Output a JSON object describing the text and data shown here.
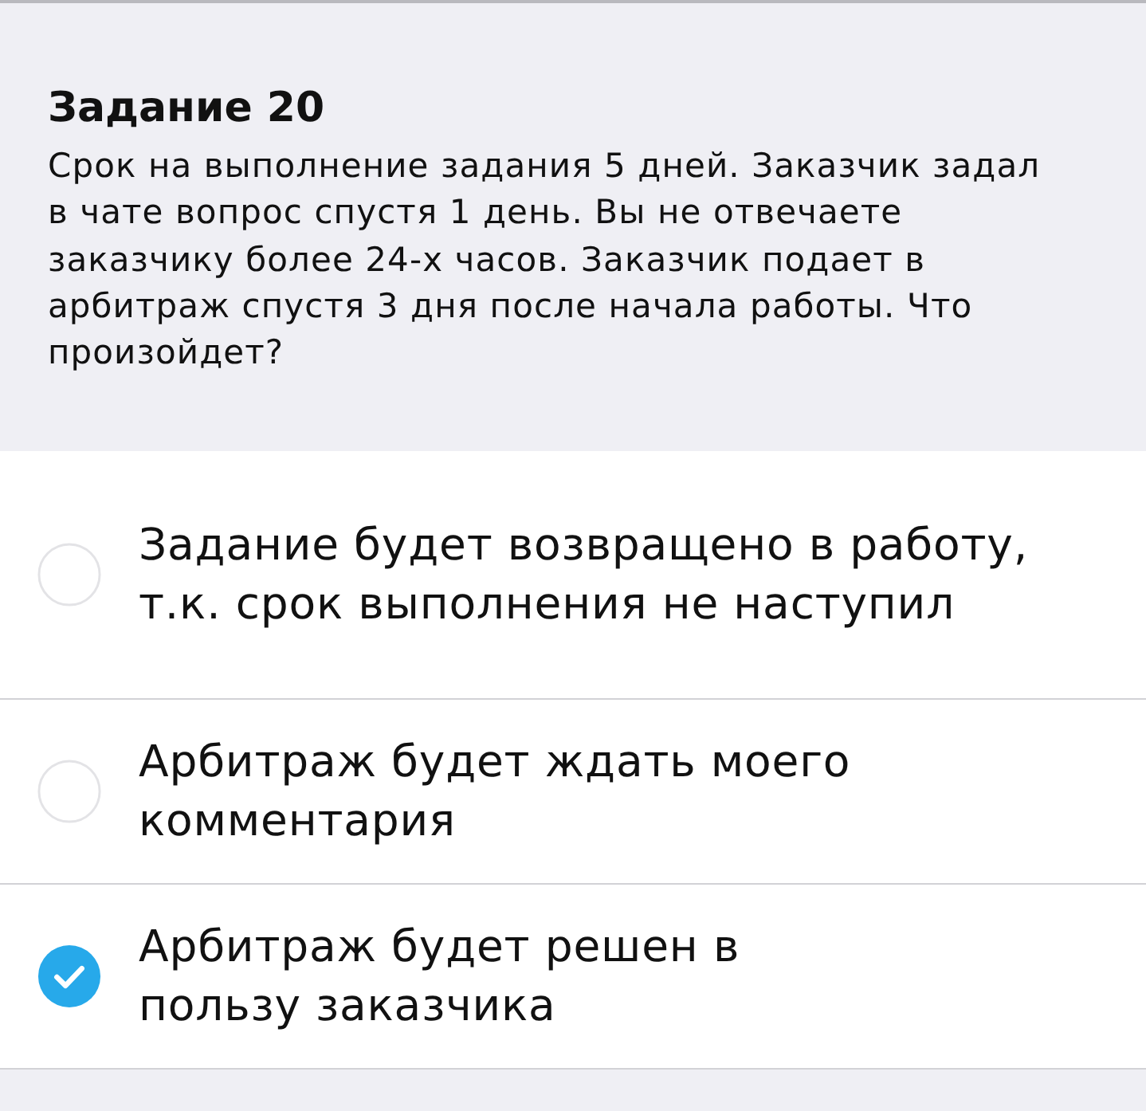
{
  "task": {
    "title": "Задание 20",
    "question": "Срок на выполнение задания 5 дней. Заказчик задал в чате вопрос спустя 1 день. Вы не отвечаете заказчику более 24-х часов. Заказчик подает в арбитраж спустя 3 дня после начала работы. Что произойдет?"
  },
  "options": [
    {
      "text": "Задание будет возвращено в работу,\nт.к. срок выполнения не наступил",
      "selected": false
    },
    {
      "text": "Арбитраж будет ждать моего\nкомментария",
      "selected": false
    },
    {
      "text": "Арбитраж будет решен в\nпользу заказчика",
      "selected": true
    }
  ]
}
